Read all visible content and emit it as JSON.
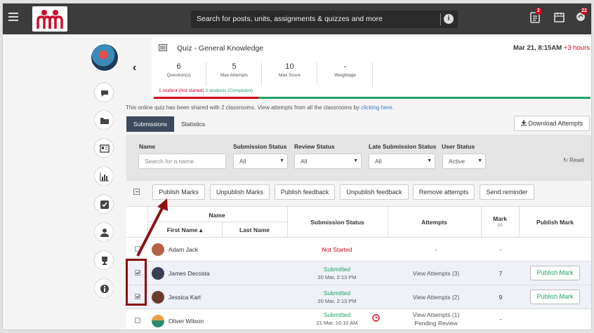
{
  "topbar": {
    "search_placeholder": "Search for posts, units, assignments & quizzes and more",
    "badge_1": "2",
    "badge_2": "22"
  },
  "quiz": {
    "title": "Quiz - General Knowledge",
    "date": "Mar 21, 8:15AM",
    "date_extra": "+3 hours",
    "stats": [
      {
        "value": "6",
        "label": "Question(s)"
      },
      {
        "value": "5",
        "label": "Max Attempts"
      },
      {
        "value": "10",
        "label": "Max Score"
      },
      {
        "value": "-",
        "label": "Weightage"
      }
    ],
    "progress_not_started": "1 student (Not started)",
    "progress_completed": "3 students (Completed)",
    "completed_fraction": 0.75
  },
  "shared_text": "This online quiz has been shared with 2 classrooms. View attempts from all the classrooms by",
  "shared_link": "clicking here.",
  "tabs": [
    {
      "label": "Submissions",
      "active": true
    },
    {
      "label": "Statistics",
      "active": false
    }
  ],
  "download_label": "Download Attempts",
  "filters": {
    "name_label": "Name",
    "name_placeholder": "Search for a name",
    "submission_status_label": "Submission Status",
    "submission_status_value": "All",
    "review_status_label": "Review Status",
    "review_status_value": "All",
    "late_submission_label": "Late Submission Status",
    "late_submission_value": "All",
    "user_status_label": "User Status",
    "user_status_value": "Active",
    "reset_label": "Reset"
  },
  "actions": {
    "publish_marks": "Publish Marks",
    "unpublish_marks": "Unpublish Marks",
    "publish_feedback": "Publish feedback",
    "unpublish_feedback": "Unpublish feedback",
    "remove_attempts": "Remove attempts",
    "send_reminder": "Send reminder"
  },
  "table": {
    "name_header": "Name",
    "first_name_header": "First Name ▴",
    "last_name_header": "Last Name",
    "submission_status_header": "Submission Status",
    "attempts_header": "Attempts",
    "mark_header": "Mark",
    "mark_sub": "10",
    "publish_mark_header": "Publish Mark",
    "rows": [
      {
        "name": "Adam Jack",
        "checked": false,
        "status": "Not Started",
        "status_date": "",
        "attempts": "-",
        "attempts_sub": "",
        "mark": "-",
        "publish": "",
        "avatar_color": "#b5624a"
      },
      {
        "name": "James Decosta",
        "checked": true,
        "status": "Submitted",
        "status_date": "20 Mar, 2:13 PM",
        "attempts": "View Attempts (3)",
        "attempts_sub": "",
        "mark": "7",
        "publish": "Publish Mark",
        "avatar_color": "#3a3f56"
      },
      {
        "name": "Jessica Karl",
        "checked": true,
        "status": "Submitted",
        "status_date": "20 Mar, 2:13 PM",
        "attempts": "View Attempts (2)",
        "attempts_sub": "",
        "mark": "9",
        "publish": "Publish Mark",
        "avatar_color": "#6b3b2e"
      },
      {
        "name": "Oliver Wilson",
        "checked": false,
        "status": "Submitted",
        "status_date": "21 Mar, 10:10 AM",
        "attempts": "View Attempts (1)",
        "attempts_sub": "Pending Review",
        "mark": "-",
        "publish": "",
        "avatar_color": "#2e8b6e"
      }
    ]
  },
  "colors": {
    "accent": "#3d4a5c",
    "success": "#23a26a",
    "danger": "#d0021b",
    "annotation": "#8b1010"
  }
}
